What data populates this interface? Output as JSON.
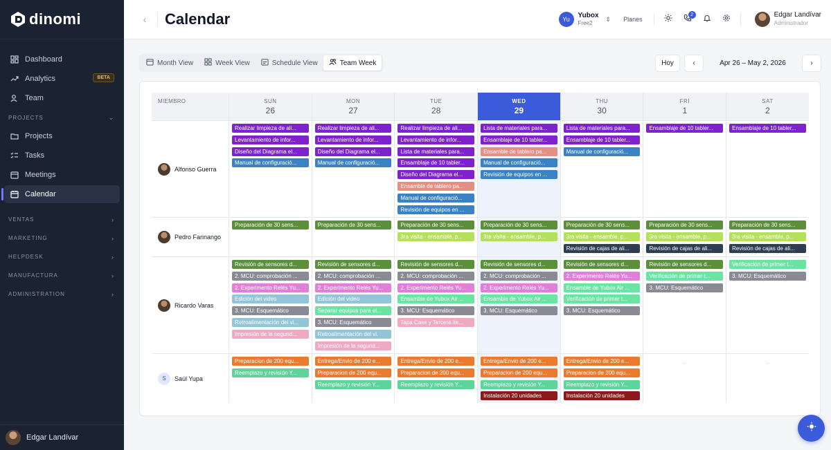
{
  "brand": {
    "name": "dinomi"
  },
  "sidebar": {
    "items": [
      {
        "label": "Dashboard",
        "icon": "dashboard-icon"
      },
      {
        "label": "Analytics",
        "icon": "analytics-icon",
        "badge": "BETA"
      },
      {
        "label": "Team",
        "icon": "team-icon"
      }
    ],
    "projects_label": "PROJECTS",
    "project_items": [
      {
        "label": "Projects",
        "icon": "folder-icon"
      },
      {
        "label": "Tasks",
        "icon": "tasks-icon"
      },
      {
        "label": "Meetings",
        "icon": "meetings-icon"
      },
      {
        "label": "Calendar",
        "icon": "calendar-icon",
        "active": true
      }
    ],
    "sections": [
      "VENTAS",
      "MARKETING",
      "HELPDESK",
      "MANUFACTURA",
      "ADMINISTRATION"
    ],
    "user_name": "Edgar Landívar"
  },
  "header": {
    "title": "Calendar",
    "org_initials": "Yu",
    "org_name": "Yubox",
    "org_plan": "Free2",
    "planes": "Planes",
    "notification_count": "2",
    "user_name": "Edgar Landívar",
    "user_role": "Administrador"
  },
  "toolbar": {
    "tabs": [
      "Month View",
      "Week View",
      "Schedule View",
      "Team Week"
    ],
    "active_tab": "Team Week",
    "today": "Hoy",
    "range": "Apr 26 – May 2, 2026"
  },
  "calendar": {
    "member_header": "MIEMBRO",
    "days": [
      {
        "dow": "SUN",
        "num": "26"
      },
      {
        "dow": "MON",
        "num": "27"
      },
      {
        "dow": "TUE",
        "num": "28"
      },
      {
        "dow": "WED",
        "num": "29",
        "today": true
      },
      {
        "dow": "THU",
        "num": "30"
      },
      {
        "dow": "FRI",
        "num": "1"
      },
      {
        "dow": "SAT",
        "num": "2"
      }
    ],
    "colors": {
      "purple": "#7e22ce",
      "blue": "#3b82c4",
      "salmon": "#e58f82",
      "olive": "#5b8f3a",
      "lime": "#b5e05a",
      "navy": "#2e3e52",
      "gray": "#8a8a95",
      "pink": "#e07fd8",
      "lightblue": "#93c5d8",
      "mint": "#6be3a3",
      "lightpink": "#f0a9c2",
      "orange": "#ea7a2e",
      "teal": "#5ed39a",
      "maroon": "#8b1a1a"
    },
    "members": [
      {
        "name": "Alfonso Guerra",
        "avatar": "photo",
        "height": 140,
        "days": [
          [
            [
              "Realizar limpieza de ali...",
              "purple"
            ],
            [
              "Levantamiento de infor...",
              "purple"
            ],
            [
              "Diseño del Diagrama el...",
              "purple"
            ],
            [
              "Manual de configuració...",
              "blue"
            ]
          ],
          [
            [
              "Realizar limpieza de ali...",
              "purple"
            ],
            [
              "Levantamiento de infor...",
              "purple"
            ],
            [
              "Diseño del Diagrama el...",
              "purple"
            ],
            [
              "Manual de configuració...",
              "blue"
            ]
          ],
          [
            [
              "Realizar limpieza de ali...",
              "purple"
            ],
            [
              "Levantamiento de infor...",
              "purple"
            ],
            [
              "Lista de materiales para...",
              "purple"
            ],
            [
              "Ensamblaje de 10 tabler...",
              "purple"
            ],
            [
              "Diseño del Diagrama el...",
              "purple"
            ],
            [
              "Ensamble de tablero pa...",
              "salmon"
            ],
            [
              "Manual de configuració...",
              "blue"
            ],
            [
              "Revisión de equipos en ...",
              "blue"
            ]
          ],
          [
            [
              "Lista de materiales para...",
              "purple"
            ],
            [
              "Ensamblaje de 10 tabler...",
              "purple"
            ],
            [
              "Ensamble de tablero pa...",
              "salmon"
            ],
            [
              "Manual de configuració...",
              "blue"
            ],
            [
              "Revisión de equipos en ...",
              "blue"
            ]
          ],
          [
            [
              "Lista de materiales para...",
              "purple"
            ],
            [
              "Ensamblaje de 10 tabler...",
              "purple"
            ],
            [
              "Manual de configuració...",
              "blue"
            ]
          ],
          [
            [
              "Ensamblaje de 10 tabler...",
              "purple"
            ]
          ],
          [
            [
              "Ensamblaje de 10 tabler...",
              "purple"
            ]
          ]
        ]
      },
      {
        "name": "Pedro Farinango",
        "avatar": "photo",
        "height": 57,
        "days": [
          [
            [
              "Preparación de 30 sens...",
              "olive"
            ]
          ],
          [
            [
              "Preparación de 30 sens...",
              "olive"
            ]
          ],
          [
            [
              "Preparación de 30 sens...",
              "olive"
            ],
            [
              "3ra visita - ensamble, p...",
              "lime"
            ]
          ],
          [
            [
              "Preparación de 30 sens...",
              "olive"
            ],
            [
              "3ra visita - ensamble, p...",
              "lime"
            ]
          ],
          [
            [
              "Preparación de 30 sens...",
              "olive"
            ],
            [
              "3ra visita - ensamble, p...",
              "lime"
            ],
            [
              "Revisión de cajas de ali...",
              "navy"
            ]
          ],
          [
            [
              "Preparación de 30 sens...",
              "olive"
            ],
            [
              "3ra visita - ensamble, p...",
              "lime"
            ],
            [
              "Revisión de cajas de ali...",
              "navy"
            ]
          ],
          [
            [
              "Preparación de 30 sens...",
              "olive"
            ],
            [
              "3ra visita - ensamble, p...",
              "lime"
            ],
            [
              "Revisión de cajas de ali...",
              "navy"
            ]
          ]
        ]
      },
      {
        "name": "Ricardo Varas",
        "avatar": "photo",
        "height": 140,
        "days": [
          [
            [
              "Revisión de sensores d...",
              "olive"
            ],
            [
              "2. MCU: comprobación ...",
              "gray"
            ],
            [
              "2. Experimento Relés Yu...",
              "pink"
            ],
            [
              "Edición del video",
              "lightblue"
            ],
            [
              "3. MCU: Esquemático",
              "gray"
            ],
            [
              "Retroalimentación del vi...",
              "lightblue"
            ],
            [
              "Impresión de la segund...",
              "lightpink"
            ]
          ],
          [
            [
              "Revisión de sensores d...",
              "olive"
            ],
            [
              "2. MCU: comprobación ...",
              "gray"
            ],
            [
              "2. Experimento Relés Yu...",
              "pink"
            ],
            [
              "Edición del video",
              "lightblue"
            ],
            [
              "Separar equipos para el...",
              "mint"
            ],
            [
              "3. MCU: Esquemático",
              "gray"
            ],
            [
              "Retroalimentación del vi...",
              "lightblue"
            ],
            [
              "Impresión de la segund...",
              "lightpink"
            ]
          ],
          [
            [
              "Revisión de sensores d...",
              "olive"
            ],
            [
              "2. MCU: comprobación ...",
              "gray"
            ],
            [
              "2. Experimento Relés Yu...",
              "pink"
            ],
            [
              "Ensamble de Yubox Air ...",
              "mint"
            ],
            [
              "3. MCU: Esquemático",
              "gray"
            ],
            [
              "Tapa Case y Tercera ite...",
              "lightpink"
            ]
          ],
          [
            [
              "Revisión de sensores d...",
              "olive"
            ],
            [
              "2. MCU: comprobación ...",
              "gray"
            ],
            [
              "2. Experimento Relés Yu...",
              "pink"
            ],
            [
              "Ensamble de Yubox Air ...",
              "mint"
            ],
            [
              "3. MCU: Esquemático",
              "gray"
            ]
          ],
          [
            [
              "Revisión de sensores d...",
              "olive"
            ],
            [
              "2. Experimento Relés Yu...",
              "pink"
            ],
            [
              "Ensamble de Yubox Air ...",
              "mint"
            ],
            [
              "Verificación de primer t...",
              "mint"
            ],
            [
              "3. MCU: Esquemático",
              "gray"
            ]
          ],
          [
            [
              "Revisión de sensores d...",
              "olive"
            ],
            [
              "Verificación de primer t...",
              "mint"
            ],
            [
              "3. MCU: Esquemático",
              "gray"
            ]
          ],
          [
            [
              "Verificación de primer t...",
              "mint"
            ],
            [
              "3. MCU: Esquemático",
              "gray"
            ]
          ]
        ]
      },
      {
        "name": "Saúl Yupa",
        "avatar": "S",
        "height": 72,
        "days": [
          [
            [
              "Preparacion de 200 equ...",
              "orange"
            ],
            [
              "Reemplazo y revisión Y...",
              "teal"
            ]
          ],
          [
            [
              "Entrega/Envio de 200 e...",
              "orange"
            ],
            [
              "Preparacion de 200 equ...",
              "orange"
            ],
            [
              "Reemplazo y revisión Y...",
              "teal"
            ]
          ],
          [
            [
              "Entrega/Envio de 200 e...",
              "orange"
            ],
            [
              "Preparacion de 200 equ...",
              "orange"
            ],
            [
              "Reemplazo y revisión Y...",
              "teal"
            ]
          ],
          [
            [
              "Entrega/Envio de 200 e...",
              "orange"
            ],
            [
              "Preparacion de 200 equ...",
              "orange"
            ],
            [
              "Reemplazo y revisión Y...",
              "teal"
            ],
            [
              "Instalación 20 unidades",
              "maroon"
            ]
          ],
          [
            [
              "Entrega/Envio de 200 e...",
              "orange"
            ],
            [
              "Preparacion de 200 equ...",
              "orange"
            ],
            [
              "Reemplazo y revisión Y...",
              "teal"
            ],
            [
              "Instalación 20 unidades",
              "maroon"
            ]
          ],
          [],
          []
        ]
      }
    ]
  }
}
